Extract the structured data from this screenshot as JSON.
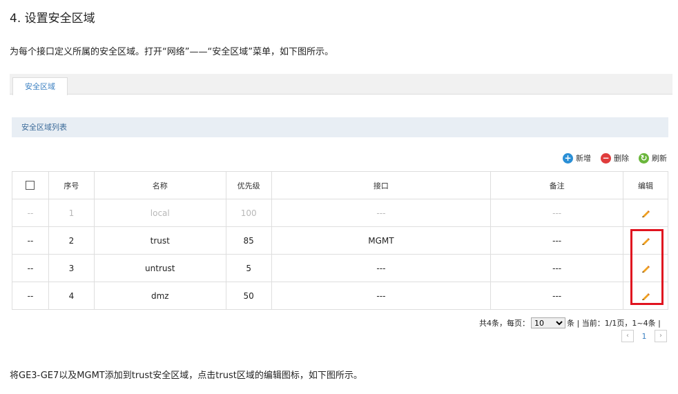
{
  "heading": "4. 设置安全区域",
  "intro": "为每个接口定义所属的安全区域。打开“网络”——“安全区域”菜单，如下图所示。",
  "tab_label": "安全区域",
  "list_title": "安全区域列表",
  "toolbar": {
    "add_label": "新增",
    "delete_label": "删除",
    "refresh_label": "刷新"
  },
  "columns": [
    "序号",
    "名称",
    "优先级",
    "接口",
    "备注",
    "编辑"
  ],
  "rows": [
    {
      "check": "--",
      "index": "1",
      "name": "local",
      "priority": "100",
      "interface": "---",
      "note": "---",
      "disabled": true
    },
    {
      "check": "--",
      "index": "2",
      "name": "trust",
      "priority": "85",
      "interface": "MGMT",
      "note": "---",
      "disabled": false
    },
    {
      "check": "--",
      "index": "3",
      "name": "untrust",
      "priority": "5",
      "interface": "---",
      "note": "---",
      "disabled": false
    },
    {
      "check": "--",
      "index": "4",
      "name": "dmz",
      "priority": "50",
      "interface": "---",
      "note": "---",
      "disabled": false
    }
  ],
  "pager": {
    "prefix": "共4条，每页：",
    "page_size": "10",
    "suffix": "条 | 当前：1/1页，1~4条 |",
    "current_page": "1"
  },
  "footer": "将GE3-GE7以及MGMT添加到trust安全区域，点击trust区域的编辑图标，如下图所示。",
  "colors": {
    "accent": "#3a7fc1",
    "highlight": "#e0131f",
    "pencil": "#f0a020"
  }
}
